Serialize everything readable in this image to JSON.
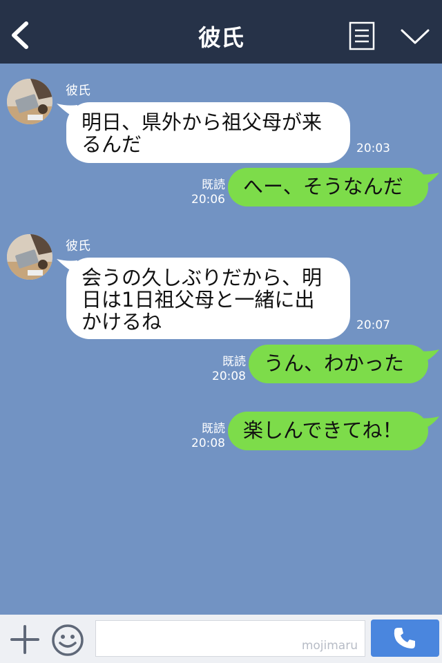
{
  "header": {
    "title": "彼氏"
  },
  "messages": [
    {
      "sender": "彼氏",
      "text": [
        "明日、県外から祖父母が来",
        "るんだ"
      ],
      "time": "20:03"
    },
    {
      "read": "既読",
      "time": "20:06",
      "text": "へー、そうなんだ"
    },
    {
      "sender": "彼氏",
      "text": [
        "会うの久しぶりだから、明",
        "日は1日祖父母と一緒に出",
        "かけるね"
      ],
      "time": "20:07"
    },
    {
      "read": "既読",
      "time": "20:08",
      "text": "うん、わかった"
    },
    {
      "read": "既読",
      "time": "20:08",
      "text": "楽しんできてね！"
    }
  ],
  "footer": {
    "watermark": "mojimaru"
  },
  "colors": {
    "header_bg": "#263248",
    "chat_bg": "#7293c3",
    "outgoing_bubble": "#7ddc4a",
    "incoming_bubble": "#ffffff",
    "call_button": "#4a86de"
  },
  "icons": [
    "chevron-left-icon",
    "menu-icon",
    "chevron-down-icon",
    "plus-icon",
    "emoji-icon",
    "phone-icon"
  ]
}
